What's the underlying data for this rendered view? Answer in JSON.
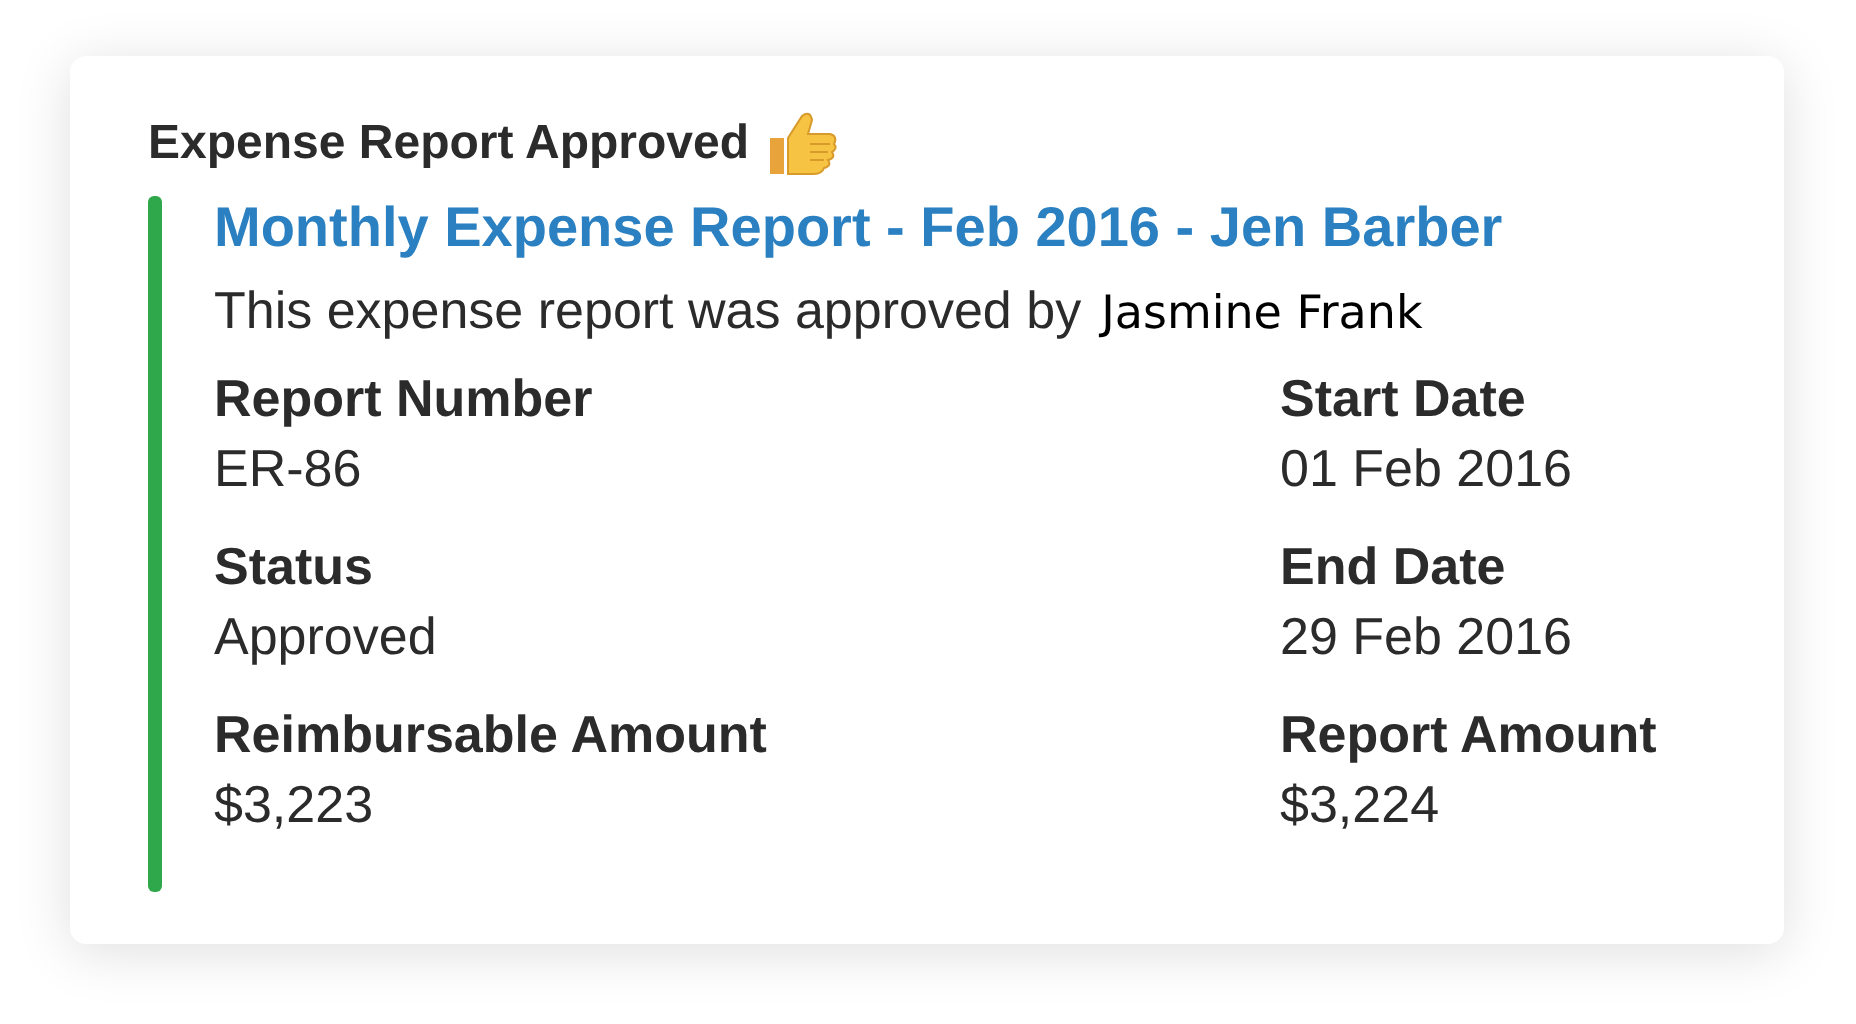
{
  "card": {
    "title": "Expense Report Approved",
    "link": "Monthly Expense Report - Feb 2016 - Jen Barber",
    "message": "This expense report was approved by",
    "approver": "Jasmine Frank",
    "fields": [
      {
        "label": "Report Number",
        "value": "ER-86"
      },
      {
        "label": "Start Date",
        "value": "01 Feb 2016"
      },
      {
        "label": "Status",
        "value": "Approved"
      },
      {
        "label": "End Date",
        "value": "29 Feb 2016"
      },
      {
        "label": "Reimbursable Amount",
        "value": "$3,223"
      },
      {
        "label": "Report Amount",
        "value": "$3,224"
      }
    ]
  }
}
